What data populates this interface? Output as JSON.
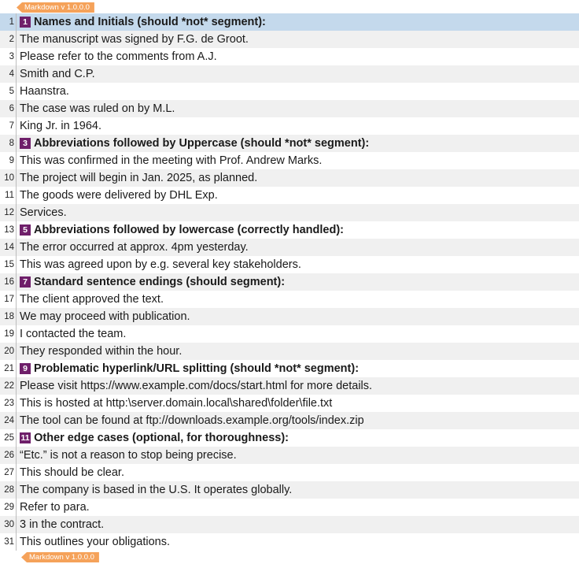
{
  "markdown_tag": "Markdown v 1.0.0.0",
  "rows": [
    {
      "n": "1",
      "badge": "1",
      "text": "Names and Initials (should *not* segment):",
      "heading": true,
      "selected": true
    },
    {
      "n": "2",
      "text": "The manuscript was signed by F.G. de Groot."
    },
    {
      "n": "3",
      "text": "Please refer to the comments from A.J."
    },
    {
      "n": "4",
      "text": "Smith and C.P."
    },
    {
      "n": "5",
      "text": "Haanstra."
    },
    {
      "n": "6",
      "text": "The case was ruled on by M.L."
    },
    {
      "n": "7",
      "text": "King Jr. in 1964."
    },
    {
      "n": "8",
      "badge": "3",
      "text": "Abbreviations followed by Uppercase (should *not* segment):",
      "heading": true
    },
    {
      "n": "9",
      "text": "This was confirmed in the meeting with Prof. Andrew Marks."
    },
    {
      "n": "10",
      "text": "The project will begin in Jan. 2025, as planned."
    },
    {
      "n": "11",
      "text": "The goods were delivered by DHL Exp."
    },
    {
      "n": "12",
      "text": "Services."
    },
    {
      "n": "13",
      "badge": "5",
      "text": "Abbreviations followed by lowercase (correctly handled):",
      "heading": true
    },
    {
      "n": "14",
      "text": "The error occurred at approx. 4pm yesterday."
    },
    {
      "n": "15",
      "text": "This was agreed upon by e.g. several key stakeholders."
    },
    {
      "n": "16",
      "badge": "7",
      "text": "Standard sentence endings (should segment):",
      "heading": true
    },
    {
      "n": "17",
      "text": "The client approved the text."
    },
    {
      "n": "18",
      "text": "We may proceed with publication."
    },
    {
      "n": "19",
      "text": "I contacted the team."
    },
    {
      "n": "20",
      "text": "They responded within the hour."
    },
    {
      "n": "21",
      "badge": "9",
      "text": "Problematic hyperlink/URL splitting (should *not* segment):",
      "heading": true
    },
    {
      "n": "22",
      "text": "Please visit https://www.example.com/docs/start.html for more details."
    },
    {
      "n": "23",
      "text": "This is hosted at http:\\server.domain.local\\shared\\folder\\file.txt"
    },
    {
      "n": "24",
      "text": "The tool can be found at ftp://downloads.example.org/tools/index.zip"
    },
    {
      "n": "25",
      "badge": "11",
      "text": "Other edge cases (optional, for thoroughness):",
      "heading": true
    },
    {
      "n": "26",
      "text": "“Etc.” is not a reason to stop being precise."
    },
    {
      "n": "27",
      "text": "This should be clear."
    },
    {
      "n": "28",
      "text": "The company is based in the U.S. It operates globally."
    },
    {
      "n": "29",
      "text": "Refer to para."
    },
    {
      "n": "30",
      "text": "3 in the contract."
    },
    {
      "n": "31",
      "text": "This outlines your obligations."
    }
  ]
}
